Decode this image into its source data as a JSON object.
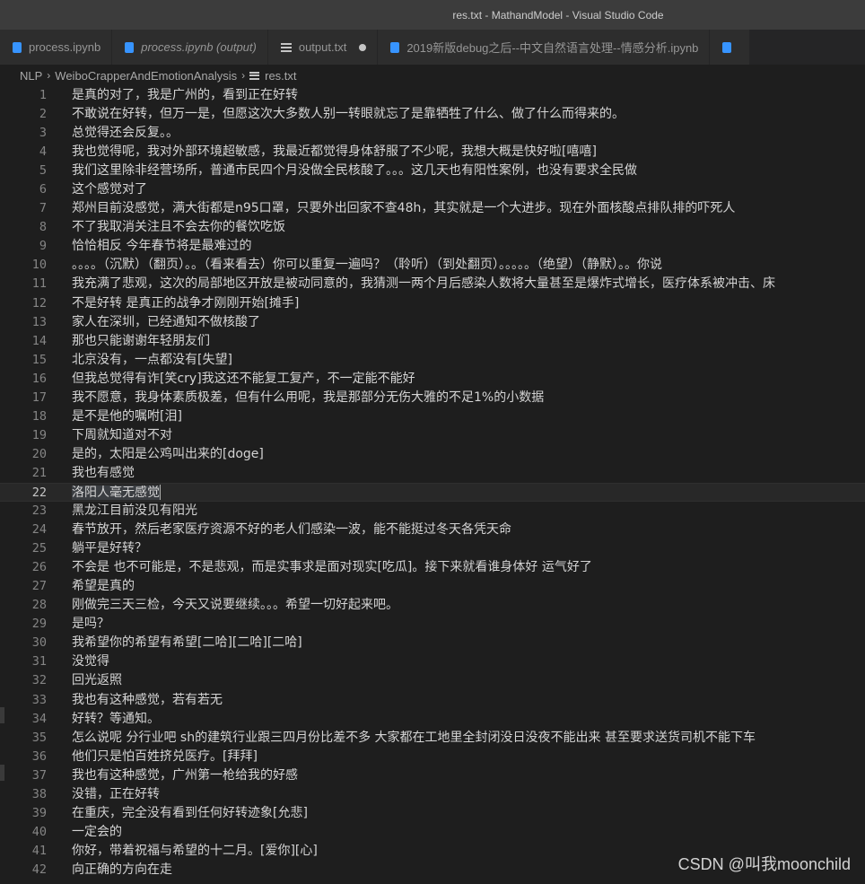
{
  "window": {
    "title": "res.txt - MathandModel - Visual Studio Code"
  },
  "tabs": [
    {
      "label": "process.ipynb",
      "icon": "notebook-icon",
      "italic": false,
      "dirty": false
    },
    {
      "label": "process.ipynb (output)",
      "icon": "notebook-icon",
      "italic": true,
      "dirty": false
    },
    {
      "label": "output.txt",
      "icon": "text-file-icon",
      "italic": false,
      "dirty": true
    },
    {
      "label": "2019新版debug之后--中文自然语言处理--情感分析.ipynb",
      "icon": "notebook-icon",
      "italic": false,
      "dirty": false
    }
  ],
  "breadcrumb": {
    "root": "NLP",
    "folder": "WeiboCrapperAndEmotionAnalysis",
    "file": "res.txt"
  },
  "editor": {
    "current_line": 22,
    "lines": [
      "是真的对了，我是广州的，看到正在好转",
      "不敢说在好转，但万一是，但愿这次大多数人别一转眼就忘了是靠牺牲了什么、做了什么而得来的。",
      "总觉得还会反复。。",
      "我也觉得呢，我对外部环境超敏感，我最近都觉得身体舒服了不少呢，我想大概是快好啦[嘻嘻]",
      "我们这里除非经营场所，普通市民四个月没做全民核酸了。。。这几天也有阳性案例，也没有要求全民做",
      "这个感觉对了",
      "郑州目前没感觉，满大街都是n95口罩，只要外出回家不查48h，其实就是一个大进步。现在外面核酸点排队排的吓死人",
      "不了我取消关注且不会去你的餐饮吃饭",
      "恰恰相反 今年春节将是最难过的",
      "。。。。（沉默）（翻页）。。（看来看去）你可以重复一遍吗？（聆听）（到处翻页）。。。。。（绝望）（静默）。。你说",
      "我充满了悲观，这次的局部地区开放是被动同意的，我猜测一两个月后感染人数将大量甚至是爆炸式增长，医疗体系被冲击、床",
      "不是好转 是真正的战争才刚刚开始[摊手]",
      "家人在深圳，已经通知不做核酸了",
      "那也只能谢谢年轻朋友们",
      "北京没有，一点都没有[失望]",
      "但我总觉得有诈[笑cry]我这还不能复工复产，不一定能不能好",
      "我不愿意，我身体素质极差，但有什么用呢，我是那部分无伤大雅的不足1%的小数据",
      "是不是他的嘱咐[泪]",
      "下周就知道对不对",
      "是的，太阳是公鸡叫出来的[doge]",
      "我也有感觉",
      "洛阳人毫无感觉",
      "黑龙江目前没见有阳光",
      "春节放开，然后老家医疗资源不好的老人们感染一波，能不能挺过冬天各凭天命",
      "躺平是好转？",
      "不会是  也不可能是，不是悲观，而是实事求是面对现实[吃瓜]。接下来就看谁身体好 运气好了",
      "希望是真的",
      "刚做完三天三检，今天又说要继续。。。希望一切好起来吧。",
      "是吗？",
      "我希望你的希望有希望[二哈][二哈][二哈]",
      "没觉得",
      "回光返照",
      "我也有这种感觉，若有若无",
      "好转？等通知。",
      "怎么说呢 分行业吧 sh的建筑行业跟三四月份比差不多 大家都在工地里全封闭没日没夜不能出来 甚至要求送货司机不能下车",
      "他们只是怕百姓挤兑医疗。[拜拜]",
      "我也有这种感觉，广州第一枪给我的好感",
      "没错，正在好转",
      "在重庆，完全没有看到任何好转迹象[允悲]",
      "一定会的",
      "你好，带着祝福与希望的十二月。[爱你][心]",
      "向正确的方向在走"
    ]
  },
  "watermark": "CSDN @叫我moonchild",
  "colors": {
    "background": "#1e1e1e",
    "titlebar": "#3c3c3c",
    "tab_inactive": "#2d2d2d",
    "text": "#d4d4d4",
    "line_number": "#858585",
    "notebook_icon": "#3794ff"
  }
}
